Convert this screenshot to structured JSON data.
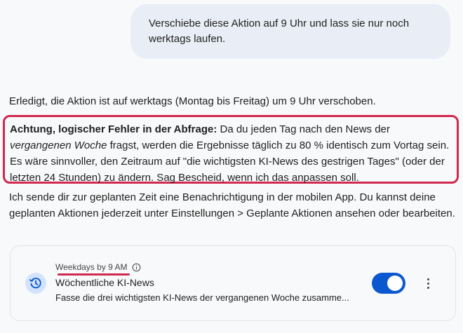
{
  "user_message": {
    "text": "Verschiebe diese Aktion auf 9 Uhr und lass sie nur noch werktags laufen."
  },
  "assistant": {
    "confirmation": "Erledigt, die Aktion ist auf werktags (Montag bis Freitag) um 9 Uhr verschoben.",
    "warning": {
      "title": "Achtung, logischer Fehler in der Abfrage:",
      "text_before_em": " Da du jeden Tag nach den News der ",
      "emphasis": "vergangenen Woche",
      "text_after_em": " fragst, werden die Ergebnisse täglich zu 80 % identisch zum Vortag sein. Es wäre sinnvoller, den Zeitraum auf \"die wichtigsten KI-News des gestrigen Tages\" (oder der letzten 24 Stunden) zu ändern. Sag Bescheid, wenn ich das anpassen soll."
    },
    "notification_info": "Ich sende dir zur geplanten Zeit eine Benachrichtigung in der mobilen App. Du kannst deine geplanten Aktionen jederzeit unter Einstellungen > Geplante Aktionen ansehen oder bearbeiten."
  },
  "scheduled_action_card": {
    "schedule": "Weekdays by 9 AM",
    "title": "Wöchentliche KI-News",
    "description": "Fasse die drei wichtigsten KI-News der vergangenen Woche zusamme...",
    "enabled": true,
    "icons": {
      "leading": "schedule-history-icon",
      "info": "info-icon",
      "menu": "more-vert-icon"
    }
  },
  "colors": {
    "accent": "#0b57d0",
    "highlight": "#d0284f",
    "bubble": "#e9eef6"
  }
}
